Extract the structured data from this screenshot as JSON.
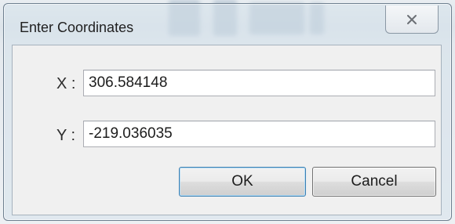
{
  "window": {
    "title": "Enter Coordinates",
    "close_icon": "close-x-icon"
  },
  "fields": {
    "x": {
      "label": "X :",
      "value": "306.584148"
    },
    "y": {
      "label": "Y :",
      "value": "-219.036035"
    }
  },
  "buttons": {
    "ok_label": "OK",
    "cancel_label": "Cancel"
  },
  "colors": {
    "titlebar": "#d6e1eb",
    "client": "#f0f0f0",
    "default_button_border": "#3c7fb1"
  }
}
